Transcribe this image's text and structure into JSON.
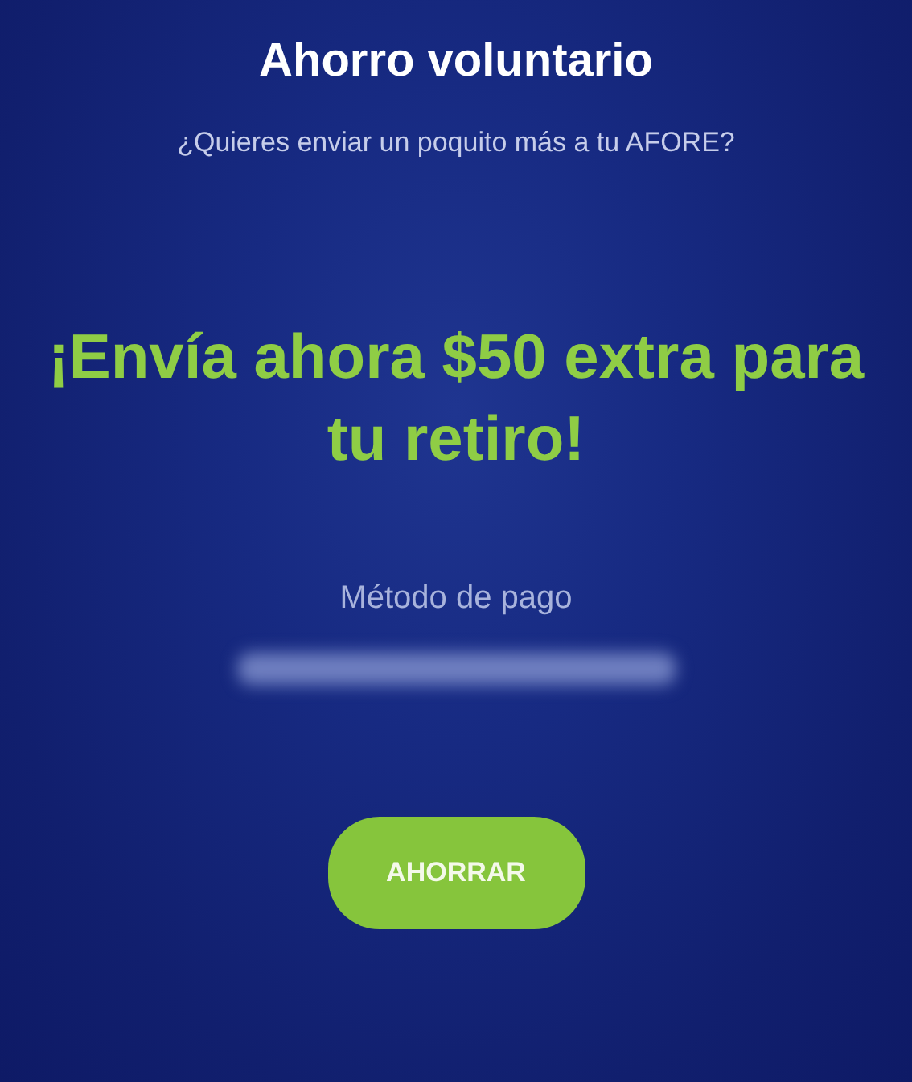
{
  "header": {
    "title": "Ahorro voluntario",
    "subtitle": "¿Quieres enviar un poquito más a tu AFORE?"
  },
  "promo": {
    "headline": "¡Envía ahora $50 extra para tu retiro!"
  },
  "payment": {
    "label": "Método de pago"
  },
  "buttons": [
    {
      "label": "AHORRAR"
    }
  ]
}
